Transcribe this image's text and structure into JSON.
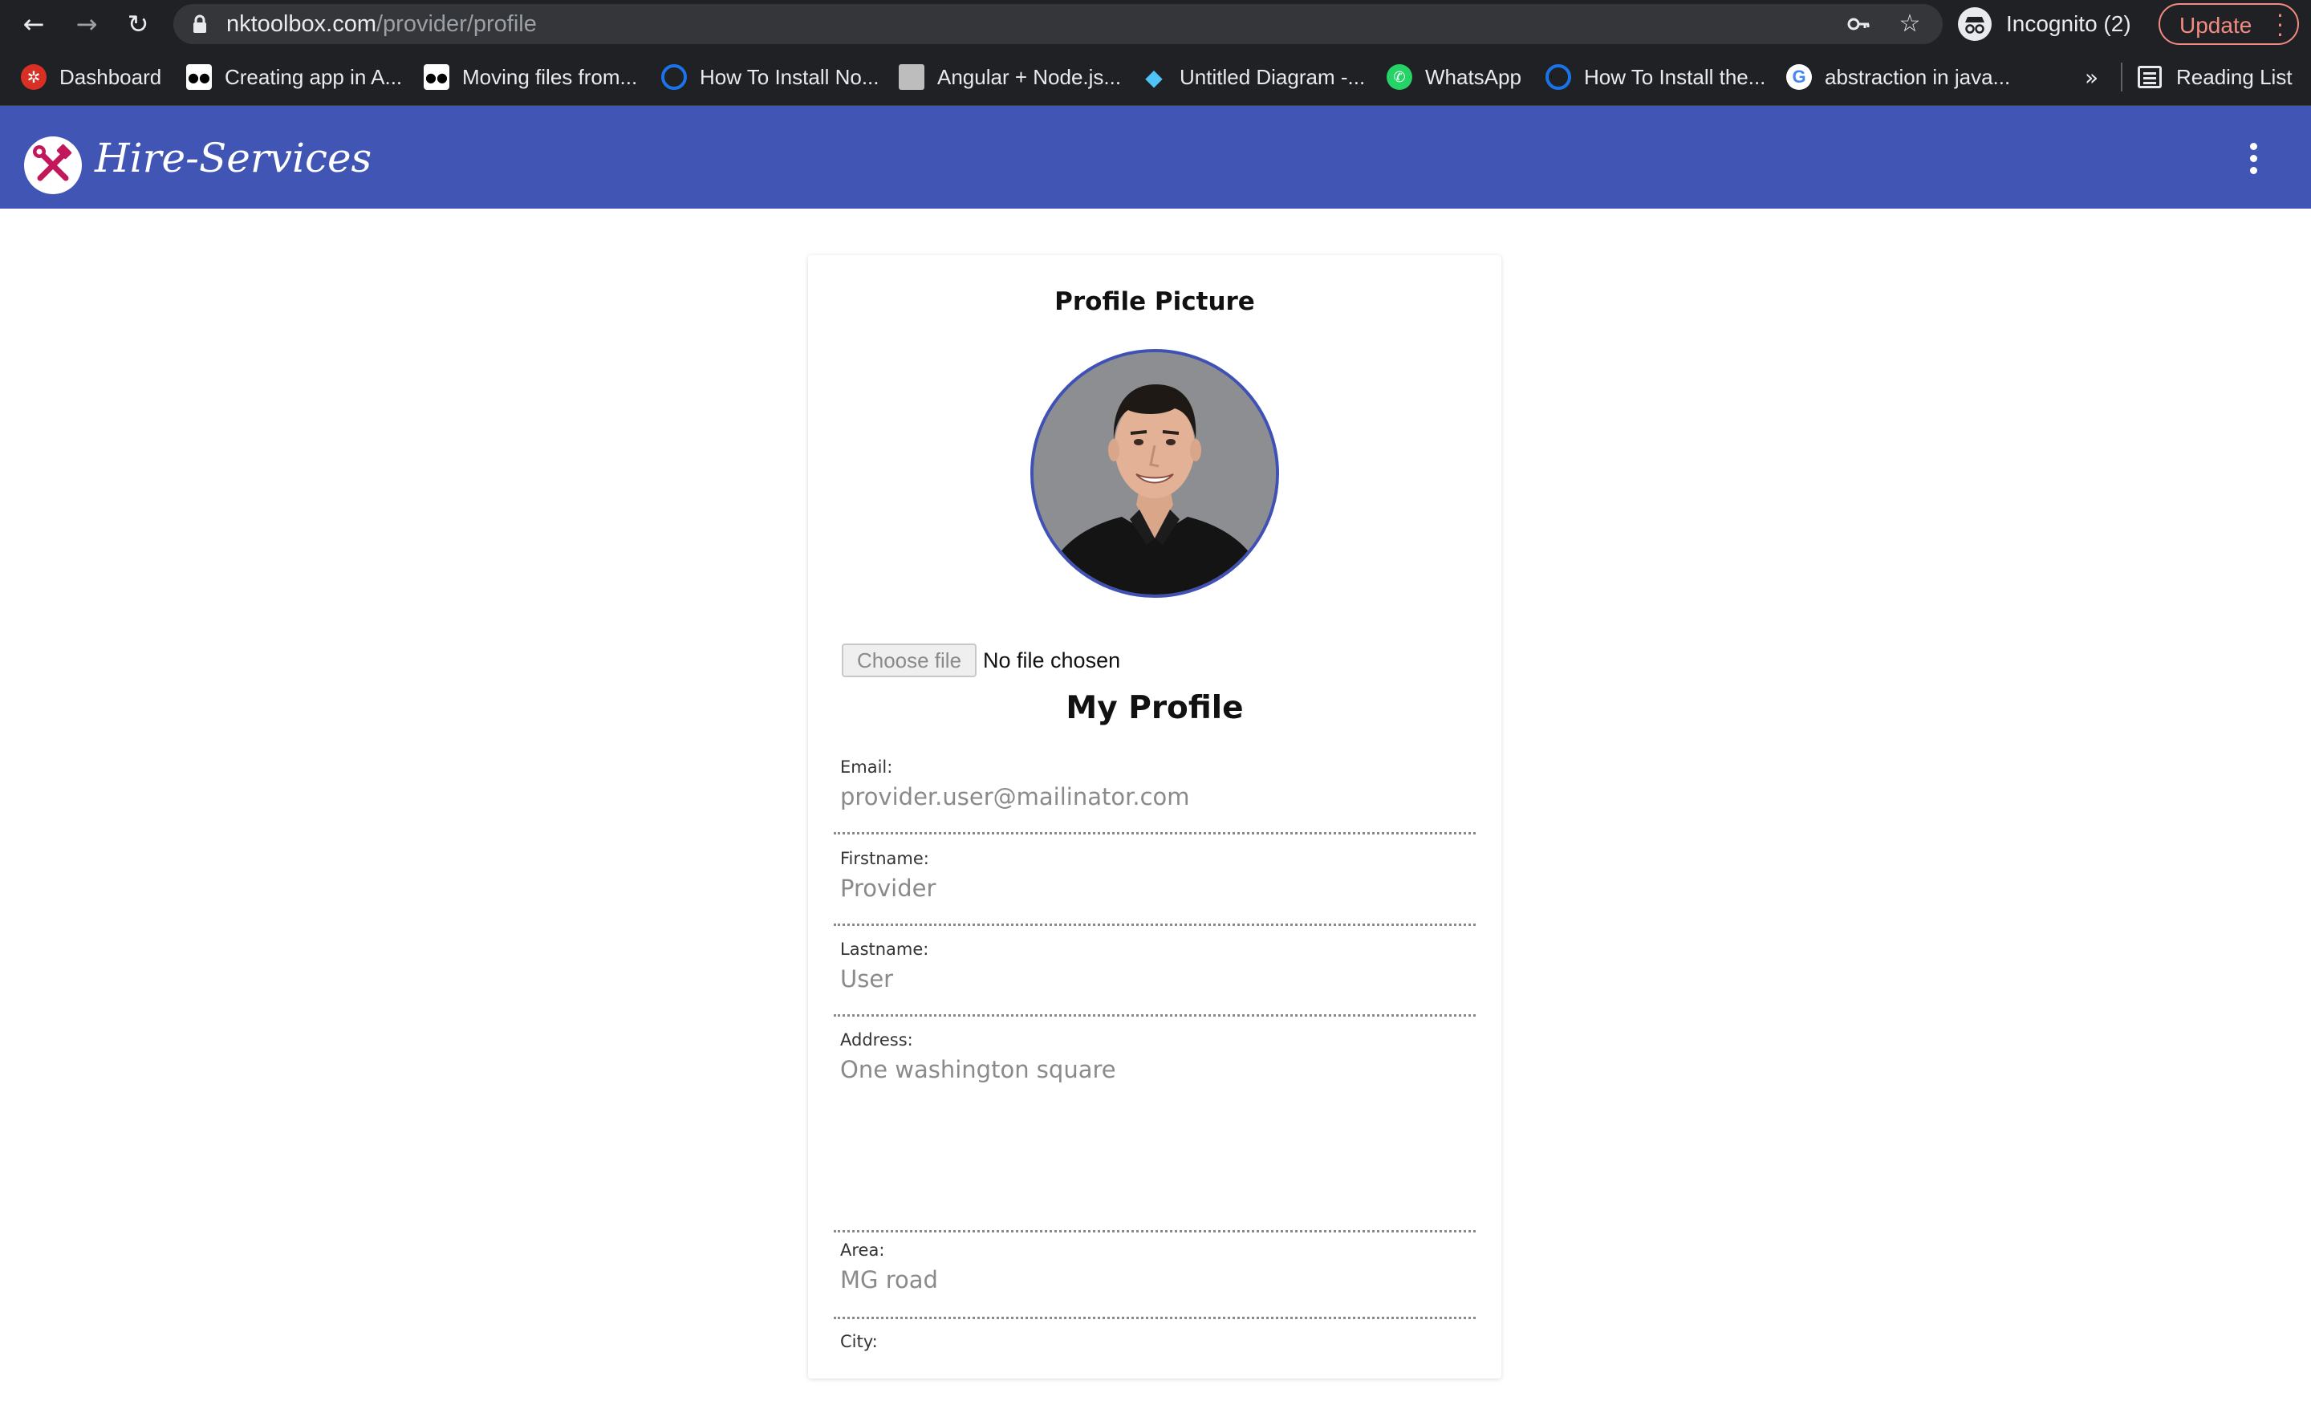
{
  "browser": {
    "url_host": "nktoolbox.com",
    "url_path": "/provider/profile",
    "incognito_label": "Incognito (2)",
    "update_label": "Update",
    "more_bookmarks": "»",
    "reading_list_label": "Reading List",
    "bookmarks": [
      {
        "label": "Dashboard",
        "icon": "gear-icon",
        "color": "#d93025"
      },
      {
        "label": "Creating app in A...",
        "icon": "medium-icon",
        "color": "#000000"
      },
      {
        "label": "Moving files from...",
        "icon": "medium-icon",
        "color": "#000000"
      },
      {
        "label": "How To Install No...",
        "icon": "digitalocean-icon",
        "color": "#1a73e8"
      },
      {
        "label": "Angular + Node.js...",
        "icon": "avatar-icon",
        "color": "#9e9e9e"
      },
      {
        "label": "Untitled Diagram -...",
        "icon": "diagram-icon",
        "color": "#4fc3f7"
      },
      {
        "label": "WhatsApp",
        "icon": "whatsapp-icon",
        "color": "#25d366"
      },
      {
        "label": "How To Install the...",
        "icon": "digitalocean-icon",
        "color": "#1a73e8"
      },
      {
        "label": "abstraction in java...",
        "icon": "google-icon",
        "color": "#ffffff"
      }
    ]
  },
  "app": {
    "brand": "Hire-Services",
    "header_color": "#4155b5",
    "logo_accent": "#c2185b"
  },
  "profile": {
    "picture_title": "Profile Picture",
    "choose_file_label": "Choose file",
    "file_status": "No file chosen",
    "title": "My Profile",
    "fields": [
      {
        "label": "Email:",
        "value": "provider.user@mailinator.com"
      },
      {
        "label": "Firstname:",
        "value": "Provider"
      },
      {
        "label": "Lastname:",
        "value": "User"
      },
      {
        "label": "Address:",
        "value": "One washington square"
      },
      {
        "label": "Area:",
        "value": "MG road"
      },
      {
        "label": "City:",
        "value": ""
      }
    ]
  }
}
